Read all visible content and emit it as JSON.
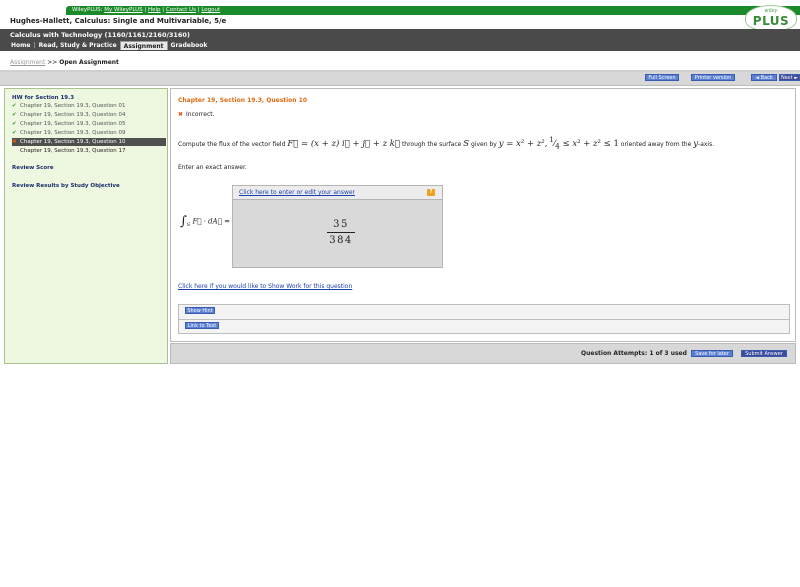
{
  "top_links": {
    "brand": "WileyPLUS:",
    "my_wileyplus": "My WileyPLUS",
    "help": "Help",
    "contact_us": "Contact Us",
    "logout": "Logout",
    "sep": "|"
  },
  "logo": {
    "small": "wiley",
    "main": "PLUS"
  },
  "book_title": "Hughes-Hallett, Calculus: Single and Multivariable, 5/e",
  "course_name": "Calculus with Technology (1160/1161/2160/3160)",
  "nav": {
    "home": "Home",
    "read_study": "Read, Study & Practice",
    "assignment": "Assignment",
    "gradebook": "Gradebook",
    "sep": "|"
  },
  "breadcrumb": {
    "parent": "Assignment",
    "sep": ">>",
    "current": "Open Assignment"
  },
  "actions": {
    "full_screen": "Full Screen",
    "printer_version": "Printer version",
    "back": "◄ Back",
    "next": "Next ►"
  },
  "sidebar": {
    "title": "HW for Section 19.3",
    "items": [
      {
        "label": "Chapter 19, Section 19.3, Question 01",
        "status": "correct"
      },
      {
        "label": "Chapter 19, Section 19.3, Question 04",
        "status": "correct"
      },
      {
        "label": "Chapter 19, Section 19.3, Question 05",
        "status": "correct"
      },
      {
        "label": "Chapter 19, Section 19.3, Question 09",
        "status": "correct"
      },
      {
        "label": "Chapter 19, Section 19.3, Question 10",
        "status": "incorrect"
      },
      {
        "label": "Chapter 19, Section 19.3, Question 17",
        "status": "none"
      }
    ],
    "review_score": "Review Score",
    "review_results": "Review Results by Study Objective"
  },
  "question": {
    "title": "Chapter 19, Section 19.3, Question 10",
    "status": "Incorrect.",
    "text_a": "Compute the flux of the vector field",
    "text_b": "through the surface",
    "text_c": "given by",
    "text_d": "oriented away from the",
    "text_e": "-axis.",
    "surface": "S",
    "axis": "y",
    "instruction": "Enter an exact answer."
  },
  "answer": {
    "edit_link": "Click here to enter or edit your answer",
    "help_glyph": "?",
    "numerator": "35",
    "denominator": "384"
  },
  "show_work_link": "Click here if you would like to Show Work for this question",
  "hint_button": "Show Hint",
  "link_text_button": "Link to Text",
  "footer": {
    "attempts": "Question Attempts: 1 of 3 used",
    "save_later": "Save for later",
    "submit": "Submit Answer"
  },
  "colors": {
    "green_bar": "#1b8a2a",
    "course_bar": "#4a4a4a",
    "question_title": "#e06a10",
    "button_blue": "#5b7fd2",
    "sidebar_bg": "#eef7e0"
  }
}
